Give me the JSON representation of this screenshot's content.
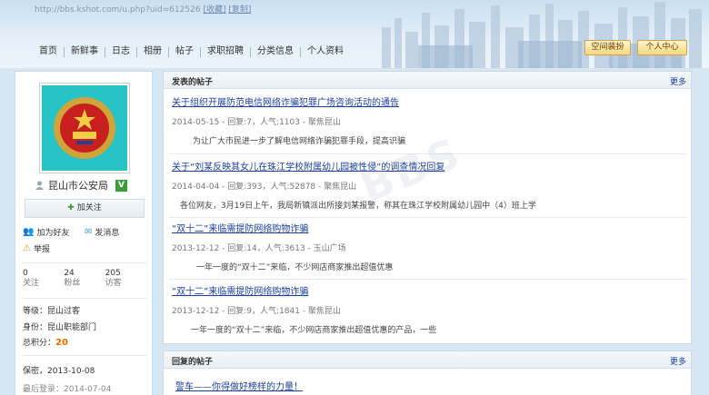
{
  "url": {
    "address": "http://bbs.kshot.com/u.php?uid=612526",
    "bookmark": "[收藏]",
    "copy": "[复制]"
  },
  "nav": [
    "首页",
    "新鲜事",
    "日志",
    "相册",
    "帖子",
    "求职招聘",
    "分类信息",
    "个人资料"
  ],
  "header_buttons": {
    "space_decorate": "空间装扮",
    "personal_center": "个人中心"
  },
  "profile": {
    "name": "昆山市公安局",
    "verified_badge": "V",
    "follow": "加关注",
    "add_friend": "加为好友",
    "send_message": "发消息",
    "report": "举报",
    "stats": [
      {
        "num": "0",
        "label": "关注"
      },
      {
        "num": "24",
        "label": "粉丝"
      },
      {
        "num": "205",
        "label": "访客"
      }
    ],
    "level_label": "等级：",
    "level": "昆山过客",
    "identity_label": "身份：",
    "identity": "昆山职能部门",
    "points_label": "总积分：",
    "points": "20",
    "secret": "保密，2013-10-08",
    "last_login": "最后登录：2014-07-04"
  },
  "posts_panel": {
    "title": "发表的帖子",
    "more": "更多",
    "posts": [
      {
        "title": "关于组织开展防范电信网络诈骗犯罪广场咨询活动的通告",
        "meta": "2014-05-15 - 回复:7，人气:1103 - 聚焦昆山",
        "excerpt": "为让广大市民进一步了解电信网络诈骗犯罪手段，提高识骗"
      },
      {
        "title": "关于“刘某反映其女儿在珠江学校附属幼儿园被性侵”的调查情况回复",
        "meta": "2014-04-04 - 回复:393，人气:52878 - 聚焦昆山",
        "excerpt": "各位网友，3月19日上午，我局新镇派出所接刘某报警，称其在珠江学校附属幼儿园中（4）班上学"
      },
      {
        "title": "“双十二”来临需提防网络购物诈骗",
        "meta": "2013-12-12 - 回复:14，人气:3613 - 玉山广场",
        "excerpt": "一年一度的“双十二”来临，不少网店商家推出超值优惠"
      },
      {
        "title": "“双十二”来临需提防网络购物诈骗",
        "meta": "2013-12-12 - 回复:9，人气:1841 - 聚焦昆山",
        "excerpt": "一年一度的“双十二”来临，不少网店商家推出超值优惠的产品，一些"
      }
    ]
  },
  "replies_panel": {
    "title": "回复的帖子",
    "more": "更多",
    "first_reply": "警车——你得做好榜样的力量！"
  },
  "colors": {
    "accent_link": "#1a3f9e",
    "points_orange": "#ee6a00",
    "avatar_bg": "#27c3c5"
  }
}
